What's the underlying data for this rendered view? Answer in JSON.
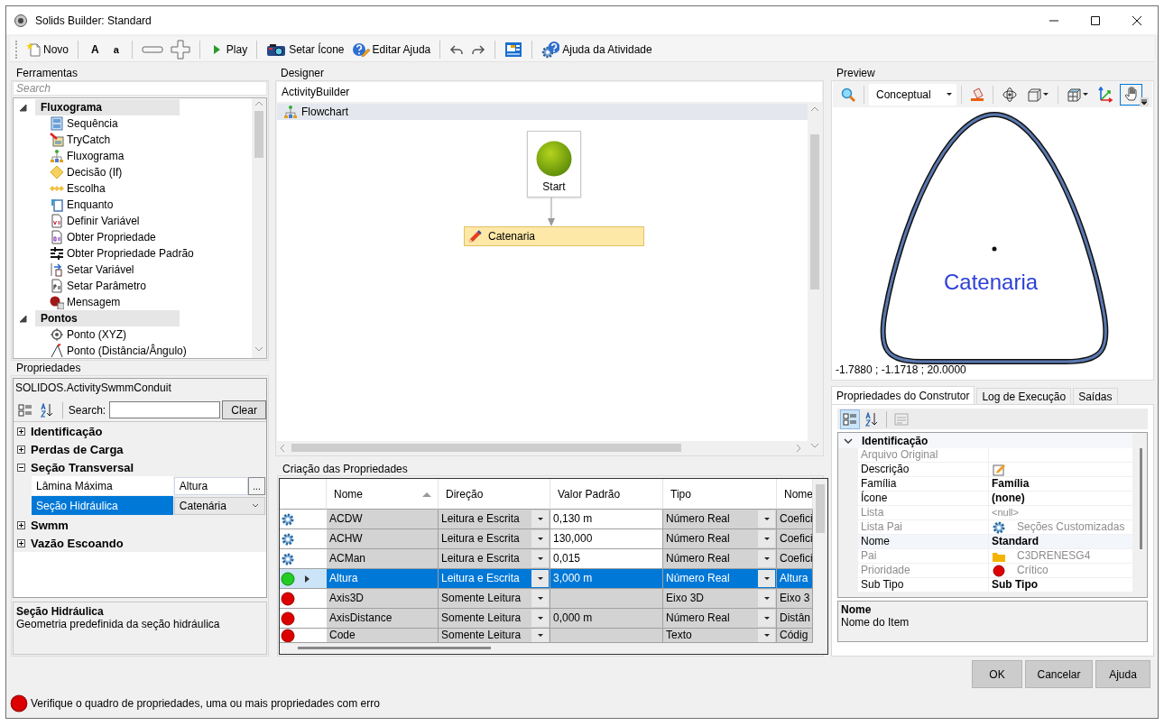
{
  "window": {
    "title": "Solids Builder: Standard"
  },
  "toolbar": [
    [
      {
        "kind": "new",
        "label": "Novo"
      }
    ],
    [
      {
        "kind": "bigfont",
        "label": "A"
      },
      {
        "kind": "smallfont",
        "label": "a"
      }
    ],
    [
      {
        "kind": "minus"
      },
      {
        "kind": "plus"
      }
    ],
    [
      {
        "kind": "play",
        "label": "Play"
      }
    ],
    [
      {
        "kind": "camera",
        "label": "Setar Ícone"
      },
      {
        "kind": "helpedit",
        "label": "Editar Ajuda"
      }
    ],
    [
      {
        "kind": "undo"
      },
      {
        "kind": "redo"
      }
    ],
    [
      {
        "kind": "panel"
      }
    ],
    [
      {
        "kind": "helpgear",
        "label": "Ajuda da Atividade"
      }
    ]
  ],
  "toolbox": {
    "title": "Ferramentas",
    "search": {
      "placeholder": "Search"
    },
    "groups": [
      {
        "label": "Fluxograma",
        "expanded": true,
        "items": [
          {
            "kind": "sequence",
            "label": "Sequência"
          },
          {
            "kind": "trycatch",
            "label": "TryCatch"
          },
          {
            "kind": "flowchart",
            "label": "Fluxograma"
          },
          {
            "kind": "decision",
            "label": "Decisão (If)"
          },
          {
            "kind": "switch",
            "label": "Escolha"
          },
          {
            "kind": "loop",
            "label": "Enquanto"
          },
          {
            "kind": "variable",
            "label": "Definir Variável"
          },
          {
            "kind": "property",
            "label": "Obter Propriedade"
          },
          {
            "kind": "defaultprop",
            "label": "Obter Propriedade Padrão"
          },
          {
            "kind": "setvar",
            "label": "Setar Variável"
          },
          {
            "kind": "parameter",
            "label": "Setar Parâmetro"
          },
          {
            "kind": "message",
            "label": "Mensagem"
          }
        ]
      },
      {
        "label": "Pontos",
        "expanded": true,
        "items": [
          {
            "kind": "point",
            "label": "Ponto (XYZ)"
          },
          {
            "kind": "angle",
            "label": "Ponto (Distância/Ângulo)"
          }
        ]
      }
    ]
  },
  "properties": {
    "title": "Propriedades",
    "object": "SOLIDOS.ActivitySwmmConduit",
    "search_label": "Search:",
    "clear_button": "Clear",
    "categories": [
      {
        "label": "Identificação",
        "expanded": false
      },
      {
        "label": "Perdas de Carga",
        "expanded": false
      },
      {
        "label": "Seção Transversal",
        "expanded": true,
        "rows": [
          {
            "name": "Lâmina Máxima",
            "value": "Altura",
            "kind": "ellipsis",
            "action": "...",
            "selected": false
          },
          {
            "name": "Seção Hidráulica",
            "value": "Catenária",
            "kind": "dropdown",
            "selected": true
          }
        ]
      },
      {
        "label": "Swmm",
        "expanded": false
      },
      {
        "label": "Vazão Escoando",
        "expanded": false
      }
    ],
    "description": {
      "title": "Seção Hidráulica",
      "text": "Geometria predefinida da seção hidráulica"
    }
  },
  "designer": {
    "title": "Designer",
    "breadcrumb": "ActivityBuilder",
    "tab": "Flowchart",
    "nodes": [
      {
        "kind": "start",
        "label": "Start"
      },
      {
        "kind": "activity",
        "label": "Catenaria"
      }
    ]
  },
  "property_table": {
    "title": "Criação das Propriedades",
    "columns": [
      {
        "label": "Nome",
        "sorted": true
      },
      {
        "label": "Direção",
        "sorted": false
      },
      {
        "label": "Valor Padrão",
        "sorted": false
      },
      {
        "label": "Tipo",
        "sorted": false
      },
      {
        "label": "Nome",
        "sorted": false
      }
    ],
    "rows": [
      {
        "kind": "gear",
        "selected": false,
        "editable": true,
        "cells": [
          "ACDW",
          "Leitura e Escrita",
          "0,130 m",
          "Número Real",
          "Coefici"
        ]
      },
      {
        "kind": "gear",
        "selected": false,
        "editable": true,
        "cells": [
          "ACHW",
          "Leitura e Escrita",
          "130,000",
          "Número Real",
          "Coefici"
        ]
      },
      {
        "kind": "gear",
        "selected": false,
        "editable": true,
        "cells": [
          "ACMan",
          "Leitura e Escrita",
          "0,015",
          "Número Real",
          "Coefici"
        ]
      },
      {
        "kind": "ok",
        "selected": true,
        "editable": true,
        "cells": [
          "Altura",
          "Leitura e Escrita",
          "3,000 m",
          "Número Real",
          "Altura"
        ]
      },
      {
        "kind": "error",
        "selected": false,
        "editable": false,
        "cells": [
          "Axis3D",
          "Somente Leitura",
          "",
          "Eixo 3D",
          "Eixo 3"
        ]
      },
      {
        "kind": "error",
        "selected": false,
        "editable": false,
        "cells": [
          "AxisDistance",
          "Somente Leitura",
          "0,000 m",
          "Número Real",
          "Distân"
        ]
      },
      {
        "kind": "error",
        "selected": false,
        "editable": false,
        "cells": [
          "Code",
          "Somente Leitura",
          "",
          "Texto",
          "Códig"
        ]
      }
    ]
  },
  "preview": {
    "title": "Preview",
    "view_style": "Conceptual",
    "tools": [
      {
        "kind": "zoom",
        "selected": false,
        "has_menu": false
      },
      {
        "kind": "style",
        "selected": false,
        "has_menu": true
      },
      {
        "kind": "bucket",
        "selected": false,
        "has_menu": false
      },
      {
        "kind": "orbit",
        "selected": false,
        "has_menu": false
      },
      {
        "kind": "cube",
        "selected": false,
        "has_menu": true
      },
      {
        "kind": "box",
        "selected": false,
        "has_menu": true
      },
      {
        "kind": "axes",
        "selected": false,
        "has_menu": false
      },
      {
        "kind": "hand",
        "selected": true,
        "has_menu": false
      }
    ],
    "label": "Catenaria",
    "coordinates": "-1.7880 ; -1.1718 ; 20.0000"
  },
  "builder": {
    "tabs": [
      {
        "label": "Propriedades do Construtor",
        "selected": true
      },
      {
        "label": "Log de Execução",
        "selected": false
      },
      {
        "label": "Saídas",
        "selected": false
      }
    ],
    "category": {
      "label": "Identificação",
      "expanded": true
    },
    "rows": [
      {
        "name": "Arquivo Original",
        "kind": "plain",
        "disabled": true,
        "selected": false
      },
      {
        "name": "Descrição",
        "kind": "edit",
        "disabled": false,
        "selected": false
      },
      {
        "name": "Família",
        "kind": "bold",
        "value": "Família",
        "disabled": false,
        "selected": false
      },
      {
        "name": "Ícone",
        "kind": "bold",
        "value": "(none)",
        "disabled": false,
        "selected": false
      },
      {
        "name": "Lista",
        "kind": "null",
        "value": "<null>",
        "disabled": true,
        "selected": false
      },
      {
        "name": "Lista Pai",
        "kind": "gear",
        "value": "Seções Customizadas",
        "disabled": true,
        "selected": false
      },
      {
        "name": "Nome",
        "kind": "bold",
        "value": "Standard",
        "disabled": false,
        "selected": true
      },
      {
        "name": "Pai",
        "kind": "folder",
        "value": "C3DRENESG4",
        "disabled": true,
        "selected": false
      },
      {
        "name": "Prioridade",
        "kind": "critical",
        "value": "Crítico",
        "disabled": true,
        "selected": false
      },
      {
        "name": "Sub Tipo",
        "kind": "bold",
        "value": "Sub Tipo",
        "disabled": false,
        "selected": false
      }
    ],
    "description": {
      "title": "Nome",
      "text": "Nome do Item"
    }
  },
  "buttons": [
    "OK",
    "Cancelar",
    "Ajuda"
  ],
  "status_bar": {
    "kind": "error",
    "text": "Verifique o quadro de propriedades, uma ou mais propriedades com erro"
  }
}
